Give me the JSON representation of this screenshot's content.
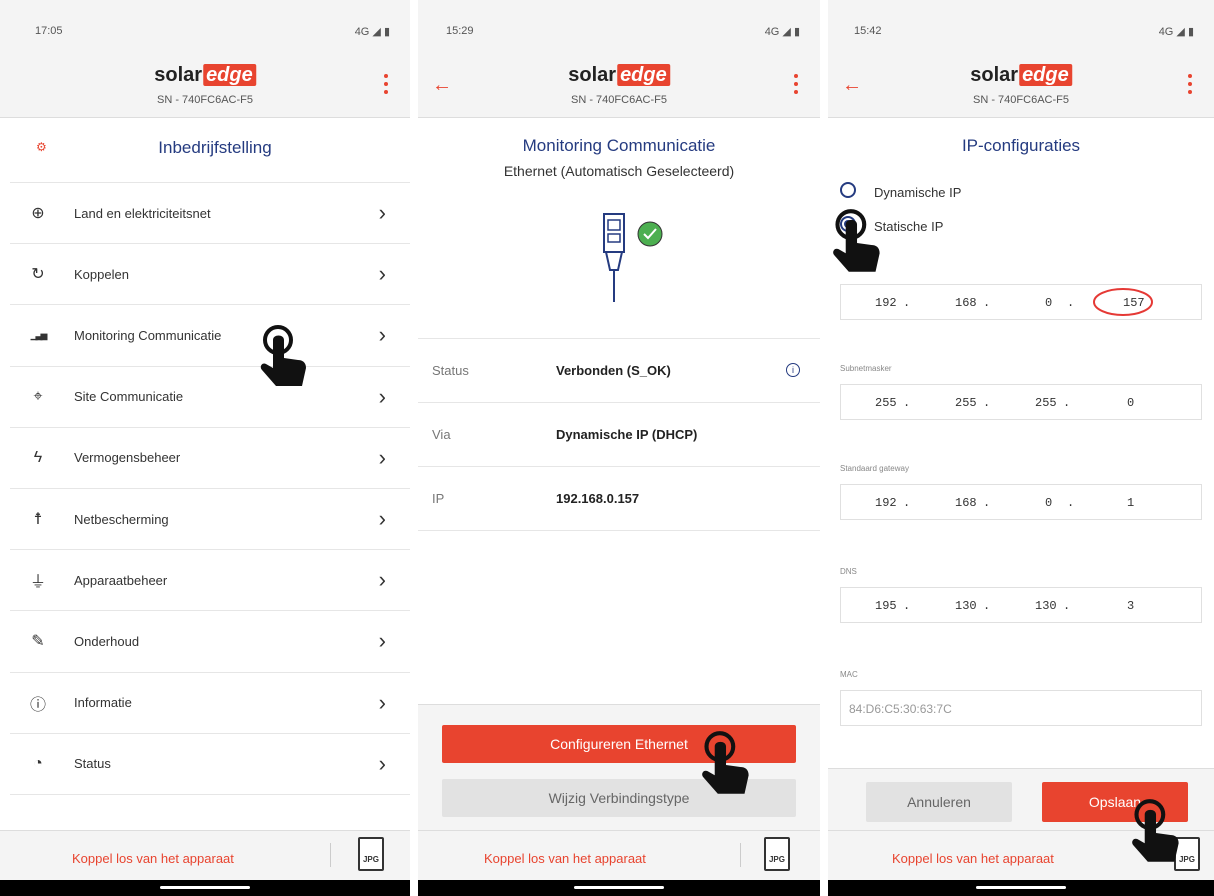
{
  "brand": {
    "solar": "solar",
    "edge": "edge"
  },
  "serial": "SN - 740FC6AC-F5",
  "colors": {
    "accent": "#e8442f",
    "title": "#253b80",
    "success": "#4caf50"
  },
  "footer": {
    "disconnect": "Koppel los van het apparaat",
    "export_icon": "jpg-file-icon",
    "jpg": "JPG"
  },
  "panel1": {
    "time": "17:05",
    "signal": "4G",
    "title": "Inbedrijfstelling",
    "items": [
      {
        "icon": "globe-icon",
        "label": "Land en elektriciteitsnet"
      },
      {
        "icon": "pairing-icon",
        "label": "Koppelen"
      },
      {
        "icon": "signal-bars-icon",
        "label": "Monitoring Communicatie"
      },
      {
        "icon": "location-pin-icon",
        "label": "Site Communicatie"
      },
      {
        "icon": "lightning-icon",
        "label": "Vermogensbeheer"
      },
      {
        "icon": "power-tower-icon",
        "label": "Netbescherming"
      },
      {
        "icon": "plug-icon",
        "label": "Apparaatbeheer"
      },
      {
        "icon": "wrench-icon",
        "label": "Onderhoud"
      },
      {
        "icon": "info-icon",
        "label": "Informatie"
      },
      {
        "icon": "gauge-icon",
        "label": "Status"
      }
    ]
  },
  "panel2": {
    "time": "15:29",
    "signal": "4G",
    "title": "Monitoring Communicatie",
    "subtitle": "Ethernet (Automatisch Geselecteerd)",
    "rows": [
      {
        "key": "Status",
        "value": "Verbonden (S_OK)"
      },
      {
        "key": "Via",
        "value": "Dynamische IP (DHCP)"
      },
      {
        "key": "IP",
        "value": "192.168.0.157"
      }
    ],
    "configure_button": "Configureren Ethernet",
    "change_button": "Wijzig Verbindingstype"
  },
  "panel3": {
    "time": "15:42",
    "signal": "4G",
    "title": "IP-configuraties",
    "radio_dynamic": "Dynamische IP",
    "radio_static": "Statische IP",
    "ip": [
      "192",
      "168",
      "0",
      "157"
    ],
    "subnet_label": "Subnetmasker",
    "subnet": [
      "255",
      "255",
      "255",
      "0"
    ],
    "gateway_label": "Standaard gateway",
    "gateway": [
      "192",
      "168",
      "0",
      "1"
    ],
    "dns_label": "DNS",
    "dns": [
      "195",
      "130",
      "130",
      "3"
    ],
    "mac_label": "MAC",
    "mac": "84:D6:C5:30:63:7C",
    "cancel_button": "Annuleren",
    "save_button": "Opslaan"
  }
}
